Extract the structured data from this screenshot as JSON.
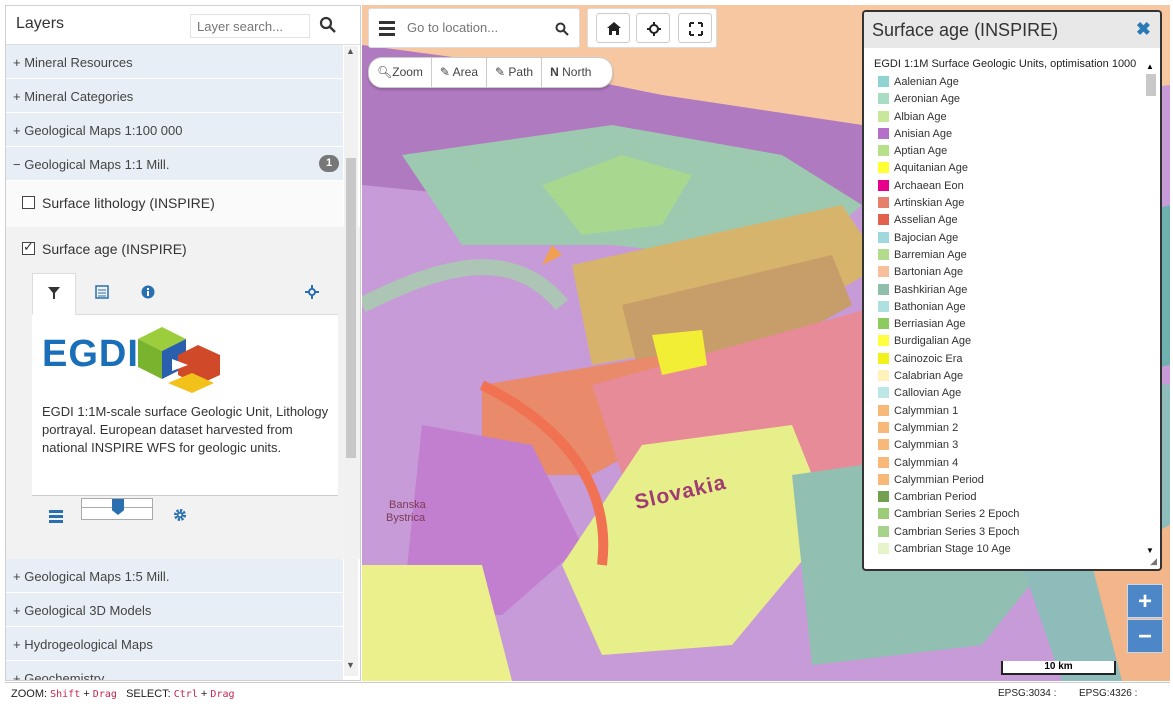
{
  "layers_panel": {
    "title": "Layers",
    "search_placeholder": "Layer search...",
    "categories_top": [
      {
        "label": "+ Mineral Resources"
      },
      {
        "label": "+ Mineral Categories"
      },
      {
        "label": "+ Geological Maps 1:100 000"
      },
      {
        "label": "− Geological Maps 1:1 Mill.",
        "badge": "1"
      }
    ],
    "layers": [
      {
        "label": "Surface lithology (INSPIRE)",
        "checked": false
      },
      {
        "label": "Surface age (INSPIRE)",
        "checked": true
      }
    ],
    "egdi_logo_text": "EGDI",
    "description": "EGDI 1:1M-scale surface Geologic Unit, Lithology portrayal. European dataset harvested from national INSPIRE WFS for geologic units.",
    "opacity_level": 0.5,
    "categories_bottom": [
      {
        "label": "+ Geological Maps 1:5 Mill."
      },
      {
        "label": "+ Geological 3D Models"
      },
      {
        "label": "+ Hydrogeological Maps"
      },
      {
        "label": "+ Geochemistry"
      }
    ]
  },
  "toolbar": {
    "location_placeholder": "Go to location...",
    "measure": [
      {
        "label": "Zoom",
        "icon": "magnifier"
      },
      {
        "label": "Area",
        "icon": "pencil"
      },
      {
        "label": "Path",
        "icon": "pencil"
      },
      {
        "label": "North",
        "icon": "N"
      }
    ]
  },
  "map": {
    "labels": {
      "country": "Slovakia",
      "city_line1": "Banska",
      "city_line2": "Bystrica"
    },
    "scale_label": "10 km",
    "zoom_in": "+",
    "zoom_out": "−"
  },
  "legend": {
    "title": "Surface age (INSPIRE)",
    "subtitle": "EGDI 1:1M Surface Geologic Units, optimisation 1000",
    "items": [
      {
        "label": "Aalenian Age",
        "color": "#8fd3d3"
      },
      {
        "label": "Aeronian Age",
        "color": "#a8dcc3"
      },
      {
        "label": "Albian Age",
        "color": "#c7e89a"
      },
      {
        "label": "Anisian Age",
        "color": "#b56fc9"
      },
      {
        "label": "Aptian Age",
        "color": "#b8e08a"
      },
      {
        "label": "Aquitanian Age",
        "color": "#ffff33"
      },
      {
        "label": "Archaean Eon",
        "color": "#e8008c"
      },
      {
        "label": "Artinskian Age",
        "color": "#e5806a"
      },
      {
        "label": "Asselian Age",
        "color": "#e3604f"
      },
      {
        "label": "Bajocian Age",
        "color": "#9fd9dd"
      },
      {
        "label": "Barremian Age",
        "color": "#b4db8c"
      },
      {
        "label": "Bartonian Age",
        "color": "#f8c09a"
      },
      {
        "label": "Bashkirian Age",
        "color": "#8fbfaa"
      },
      {
        "label": "Bathonian Age",
        "color": "#aee0e0"
      },
      {
        "label": "Berriasian Age",
        "color": "#8ccc5e"
      },
      {
        "label": "Burdigalian Age",
        "color": "#ffff40"
      },
      {
        "label": "Cainozoic Era",
        "color": "#f2f21a"
      },
      {
        "label": "Calabrian Age",
        "color": "#fff2bb"
      },
      {
        "label": "Callovian Age",
        "color": "#bde6e6"
      },
      {
        "label": "Calymmian 1",
        "color": "#f8b878"
      },
      {
        "label": "Calymmian 2",
        "color": "#f8b878"
      },
      {
        "label": "Calymmian 3",
        "color": "#f8b878"
      },
      {
        "label": "Calymmian 4",
        "color": "#f8b878"
      },
      {
        "label": "Calymmian Period",
        "color": "#f8b878"
      },
      {
        "label": "Cambrian Period",
        "color": "#73a050"
      },
      {
        "label": "Cambrian Series 2 Epoch",
        "color": "#9dcc78"
      },
      {
        "label": "Cambrian Series 3 Epoch",
        "color": "#a6d28c"
      },
      {
        "label": "Cambrian Stage 10 Age",
        "color": "#e6f5c9"
      }
    ]
  },
  "status": {
    "zoom_label": "ZOOM:",
    "zoom_key1": "Shift",
    "zoom_key2": "Drag",
    "select_label": "SELECT:",
    "select_key1": "Ctrl",
    "select_key2": "Drag",
    "plus": "+",
    "epsg1": "EPSG:3034 :",
    "epsg2": "EPSG:4326 :"
  }
}
